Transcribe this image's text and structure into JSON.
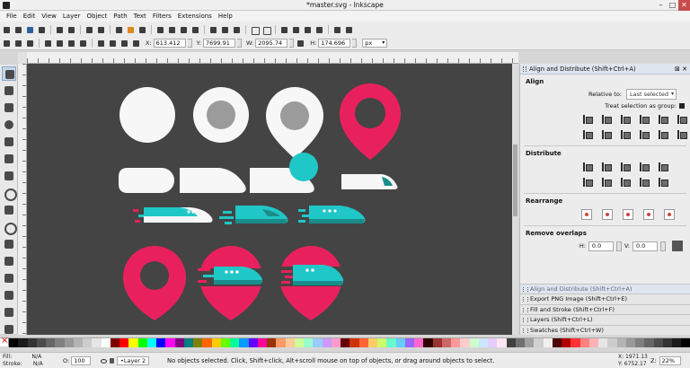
{
  "window": {
    "title": "*master.svg - Inkscape",
    "controls": [
      "–",
      "□",
      "✕"
    ]
  },
  "menu": [
    "File",
    "Edit",
    "View",
    "Layer",
    "Object",
    "Path",
    "Text",
    "Filters",
    "Extensions",
    "Help"
  ],
  "toolbar": {
    "x_label": "X:",
    "x_value": "613.412",
    "y_label": "Y:",
    "y_value": "7699.91",
    "w_label": "W:",
    "w_value": "2095.74",
    "h_label": "H:",
    "h_value": "174.696",
    "unit": "px"
  },
  "tools": [
    "selector-tool",
    "node-tool",
    "tweak-tool",
    "zoom-tool",
    "measure-tool",
    "rect-tool",
    "3dbox-tool",
    "ellipse-tool",
    "star-tool",
    "spiral-tool",
    "pencil-tool",
    "pen-tool",
    "calligraphy-tool",
    "text-tool",
    "spray-tool",
    "eraser-tool"
  ],
  "colors": {
    "canvas": "#444444",
    "white": "#f7f7f7",
    "grey": "#9b9b9b",
    "pink": "#e8215e",
    "teal": "#20c7c7",
    "dark_teal": "#1b8c8c"
  },
  "dock": {
    "title": "Align and Distribute (Shift+Ctrl+A)",
    "align": {
      "heading": "Align",
      "relative_label": "Relative to:",
      "relative_value": "Last selected",
      "group_label": "Treat selection as group:"
    },
    "distribute_heading": "Distribute",
    "rearrange_heading": "Rearrange",
    "overlaps": {
      "heading": "Remove overlaps",
      "h_label": "H:",
      "h_value": "0.0",
      "v_label": "V:",
      "v_value": "0.0"
    },
    "tabs": [
      "Align and Distribute (Shift+Ctrl+A)",
      "Export PNG Image (Shift+Ctrl+E)",
      "Fill and Stroke (Shift+Ctrl+F)",
      "Layers (Shift+Ctrl+L)",
      "Swatches (Shift+Ctrl+W)"
    ]
  },
  "palette": [
    "#000000",
    "#1a1a1a",
    "#333333",
    "#4d4d4d",
    "#666666",
    "#808080",
    "#999999",
    "#b3b3b3",
    "#cccccc",
    "#e6e6e6",
    "#ffffff",
    "#800000",
    "#ff0000",
    "#ffff00",
    "#00ff00",
    "#00ffff",
    "#0000ff",
    "#ff00ff",
    "#800080",
    "#008080",
    "#808000",
    "#ff6600",
    "#ffcc00",
    "#66ff00",
    "#00ff99",
    "#0099ff",
    "#6600ff",
    "#ff0099",
    "#993300",
    "#ff9966",
    "#ffcc99",
    "#ccff99",
    "#99ffcc",
    "#99ccff",
    "#cc99ff",
    "#ff99cc",
    "#660000",
    "#cc3300",
    "#ff6633",
    "#ffcc66",
    "#ccff66",
    "#66ffcc",
    "#66ccff",
    "#9966ff",
    "#ff66cc",
    "#330000",
    "#993333",
    "#cc6666",
    "#ff9999",
    "#ffcccc",
    "#ccffcc",
    "#cce6ff",
    "#e6ccff",
    "#ffe6f2",
    "#404040",
    "#707070",
    "#a0a0a0",
    "#d0d0d0",
    "#f0f0f0",
    "#4d0000",
    "#b30000",
    "#ff3333",
    "#ff8080",
    "#ffb3b3",
    "#e6e6e6",
    "#cccccc",
    "#b3b3b3",
    "#999999",
    "#808080",
    "#666666",
    "#4d4d4d",
    "#333333",
    "#1a1a1a",
    "#000000"
  ],
  "status": {
    "fill_label": "Fill:",
    "fill_value": "N/A",
    "stroke_label": "Stroke:",
    "stroke_value": "N/A",
    "opacity_label": "O:",
    "opacity_value": "100",
    "layer": "•Layer 2",
    "message": "No objects selected. Click, Shift+click, Alt+scroll mouse on top of objects, or drag around objects to select.",
    "x_readout": "X: 1971.13",
    "y_readout": "Y: 6752.17",
    "zoom_label": "Z:",
    "zoom_value": "22%"
  }
}
